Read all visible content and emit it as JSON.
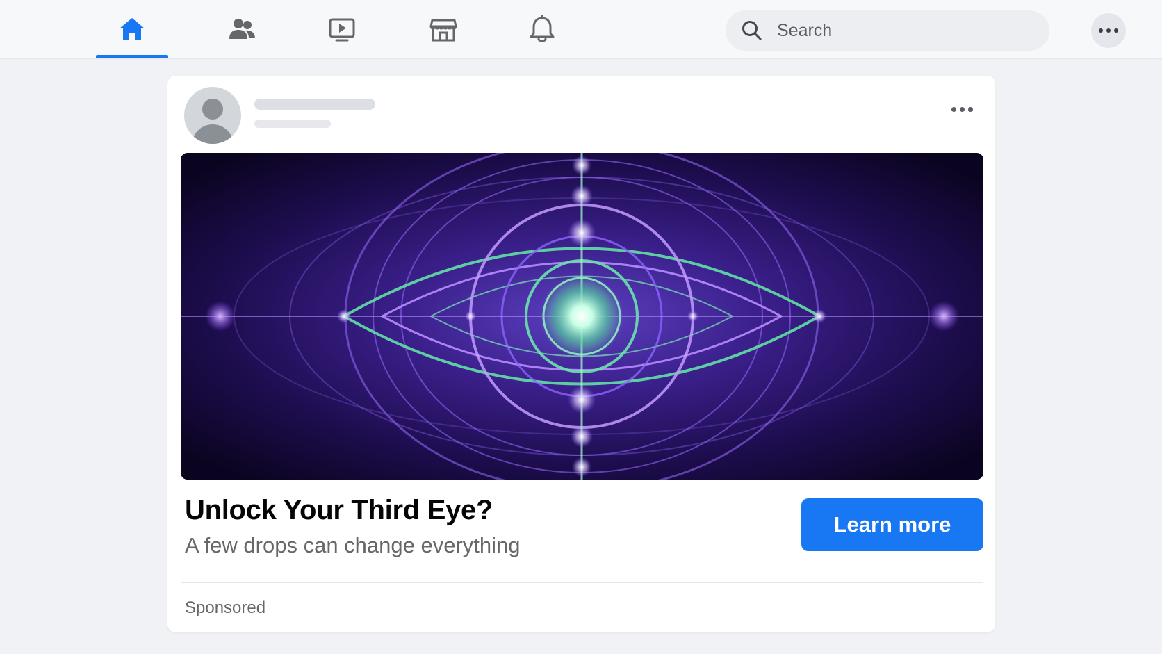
{
  "nav": {
    "tabs": [
      {
        "icon": "home-icon",
        "active": true
      },
      {
        "icon": "friends-icon",
        "active": false
      },
      {
        "icon": "watch-icon",
        "active": false
      },
      {
        "icon": "marketplace-icon",
        "active": false
      },
      {
        "icon": "notifications-icon",
        "active": false
      }
    ],
    "accent_color": "#1877f2",
    "inactive_icon_color": "#65676b"
  },
  "search": {
    "placeholder": "Search",
    "icon": "search-icon"
  },
  "menu": {
    "icon": "more-options-icon"
  },
  "post": {
    "avatar_icon": "default-avatar-icon",
    "options_icon": "more-options-icon",
    "image_description_icon": "third-eye-artwork",
    "headline": "Unlock Your Third Eye?",
    "subline": "A few drops can change everything",
    "cta_label": "Learn more",
    "cta_color": "#1877f2",
    "sponsored_label": "Sponsored"
  }
}
